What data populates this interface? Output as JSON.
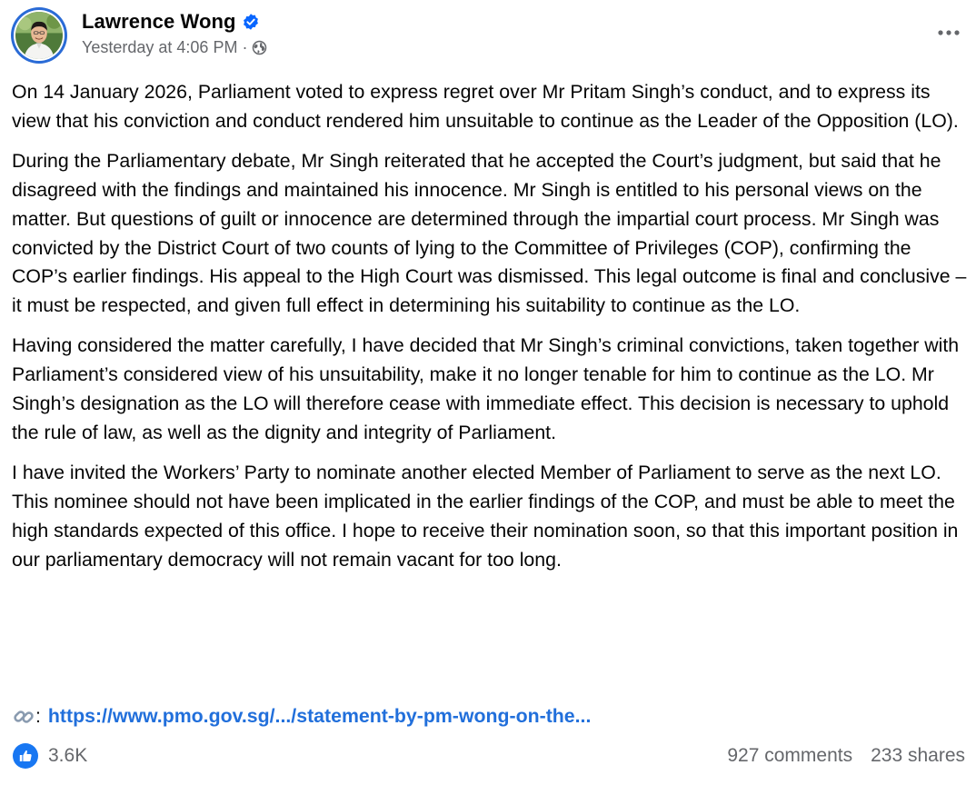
{
  "author": {
    "name": "Lawrence Wong",
    "timestamp": "Yesterday at 4:06 PM",
    "separator": "·",
    "privacy_icon": "globe-icon",
    "verified_icon": "verified-badge-icon"
  },
  "header": {
    "more_icon": "more-options-icon"
  },
  "post": {
    "paragraphs": [
      "On 14 January 2026, Parliament voted to express regret over Mr Pritam Singh’s conduct, and to express its view that his conviction and conduct rendered him unsuitable to continue as the Leader of the Opposition (LO).",
      "During the Parliamentary debate, Mr Singh reiterated that he accepted the Court’s judgment, but said that he disagreed with the findings and maintained his innocence. Mr Singh is entitled to his personal views on the matter. But questions of guilt or innocence are determined through the impartial court process.  Mr Singh was convicted by the District Court of two counts of lying to the Committee of Privileges (COP), confirming the COP’s earlier findings. His appeal to the High Court was dismissed.  This legal outcome is final and conclusive – it must be respected, and given full effect in determining his suitability to continue as the LO.",
      "Having considered the matter carefully, I have decided that Mr Singh’s criminal convictions, taken together with Parliament’s considered view of his unsuitability, make it no longer tenable for him to continue as the LO. Mr Singh’s designation as the LO will therefore cease with immediate effect. This decision is necessary to uphold the rule of law, as well as the dignity and integrity of Parliament.",
      "I have invited the Workers’ Party to nominate another elected Member of Parliament to serve as the next LO. This nominee should not have been implicated in the earlier findings of the COP, and must be able to meet the high standards expected of this office. I hope to receive their nomination soon, so that this important position in our parliamentary democracy will not remain vacant for too long."
    ],
    "link_emoji": "link-icon",
    "link_colon": ":",
    "link_text": "https://www.pmo.gov.sg/.../statement-by-pm-wong-on-the..."
  },
  "footer": {
    "like_icon": "thumbs-up-icon",
    "reaction_count": "3.6K",
    "comments": "927 comments",
    "shares": "233 shares"
  },
  "colors": {
    "link": "#216fdb",
    "meta": "#65676b",
    "like_blue": "#1877f2",
    "verified_blue": "#0866ff"
  }
}
